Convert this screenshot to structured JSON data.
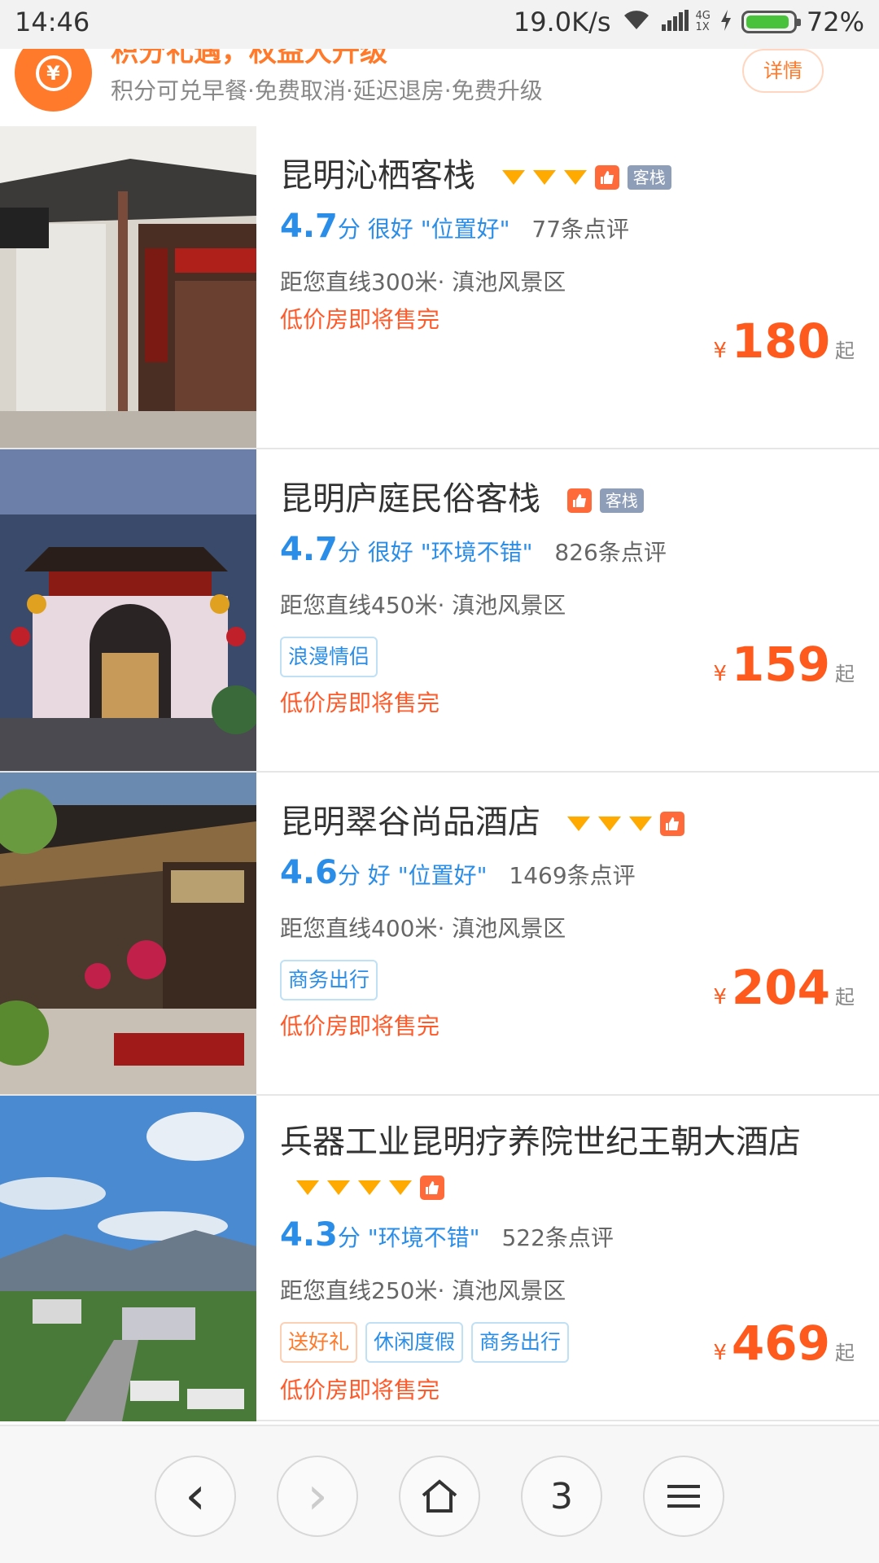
{
  "status_bar": {
    "time": "14:46",
    "speed": "19.0K/s",
    "network_top": "4G",
    "network_bottom": "1X",
    "battery": "72%"
  },
  "promo": {
    "headline": "积分礼遇，权益大升级",
    "subline": "积分可兑早餐·免费取消·延迟退房·免费升级",
    "detail_button": "详情",
    "coin_symbol": "¥"
  },
  "hotels": [
    {
      "name": "昆明沁栖客栈",
      "diamonds": 3,
      "type_tag": "客栈",
      "score": "4.7",
      "score_unit": "分",
      "grade": "很好",
      "highlight": "\"位置好\"",
      "reviews": "77条点评",
      "distance": "距您直线300米· 滇池风景区",
      "chips": [],
      "sold_out": "低价房即将售完",
      "currency": "¥",
      "price": "180",
      "price_suffix": "起"
    },
    {
      "name": "昆明庐庭民俗客栈",
      "diamonds": 0,
      "type_tag": "客栈",
      "score": "4.7",
      "score_unit": "分",
      "grade": "很好",
      "highlight": "\"环境不错\"",
      "reviews": "826条点评",
      "distance": "距您直线450米· 滇池风景区",
      "chips": [
        "浪漫情侣"
      ],
      "sold_out": "低价房即将售完",
      "currency": "¥",
      "price": "159",
      "price_suffix": "起"
    },
    {
      "name": "昆明翠谷尚品酒店",
      "diamonds": 3,
      "type_tag": "",
      "score": "4.6",
      "score_unit": "分",
      "grade": "好",
      "highlight": "\"位置好\"",
      "reviews": "1469条点评",
      "distance": "距您直线400米· 滇池风景区",
      "chips": [
        "商务出行"
      ],
      "sold_out": "低价房即将售完",
      "currency": "¥",
      "price": "204",
      "price_suffix": "起"
    },
    {
      "name": "兵器工业昆明疗养院世纪王朝大酒店",
      "diamonds": 4,
      "type_tag": "",
      "score": "4.3",
      "score_unit": "分",
      "grade": "",
      "highlight": "\"环境不错\"",
      "reviews": "522条点评",
      "distance": "距您直线250米· 滇池风景区",
      "chips": [
        "送好礼",
        "休闲度假",
        "商务出行"
      ],
      "sold_out": "低价房即将售完",
      "currency": "¥",
      "price": "469",
      "price_suffix": "起"
    }
  ],
  "bottom_nav": {
    "back_icon": "‹",
    "forward_icon": "›",
    "home_icon": "home-icon",
    "tabs_count": "3",
    "menu_icon": "menu-icon"
  },
  "colors": {
    "accent_orange": "#ff5a1e",
    "score_blue": "#2a8ee8",
    "diamond": "#ffaa00"
  }
}
